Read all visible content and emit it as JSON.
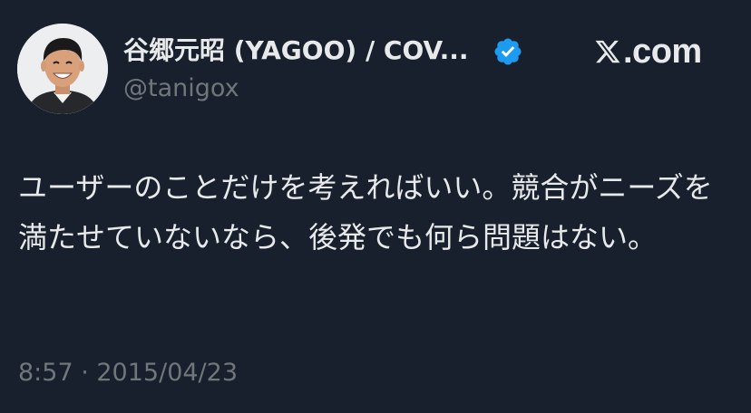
{
  "tweet": {
    "author": {
      "display_name": "谷郷元昭 (YAGOO) / COV...",
      "handle": "@tanigox",
      "verified": true
    },
    "text": "ユーザーのことだけを考えればいい。競合がニーズを満たせていないなら、後発でも何ら問題はない。",
    "timestamp": "8:57 · 2015/04/23"
  },
  "site": {
    "label": ".com",
    "icon": "x-logo-icon"
  },
  "colors": {
    "background": "#17202c",
    "text_primary": "#e7e9ea",
    "text_secondary": "#71767b",
    "verified_badge": "#1d9bf0"
  }
}
